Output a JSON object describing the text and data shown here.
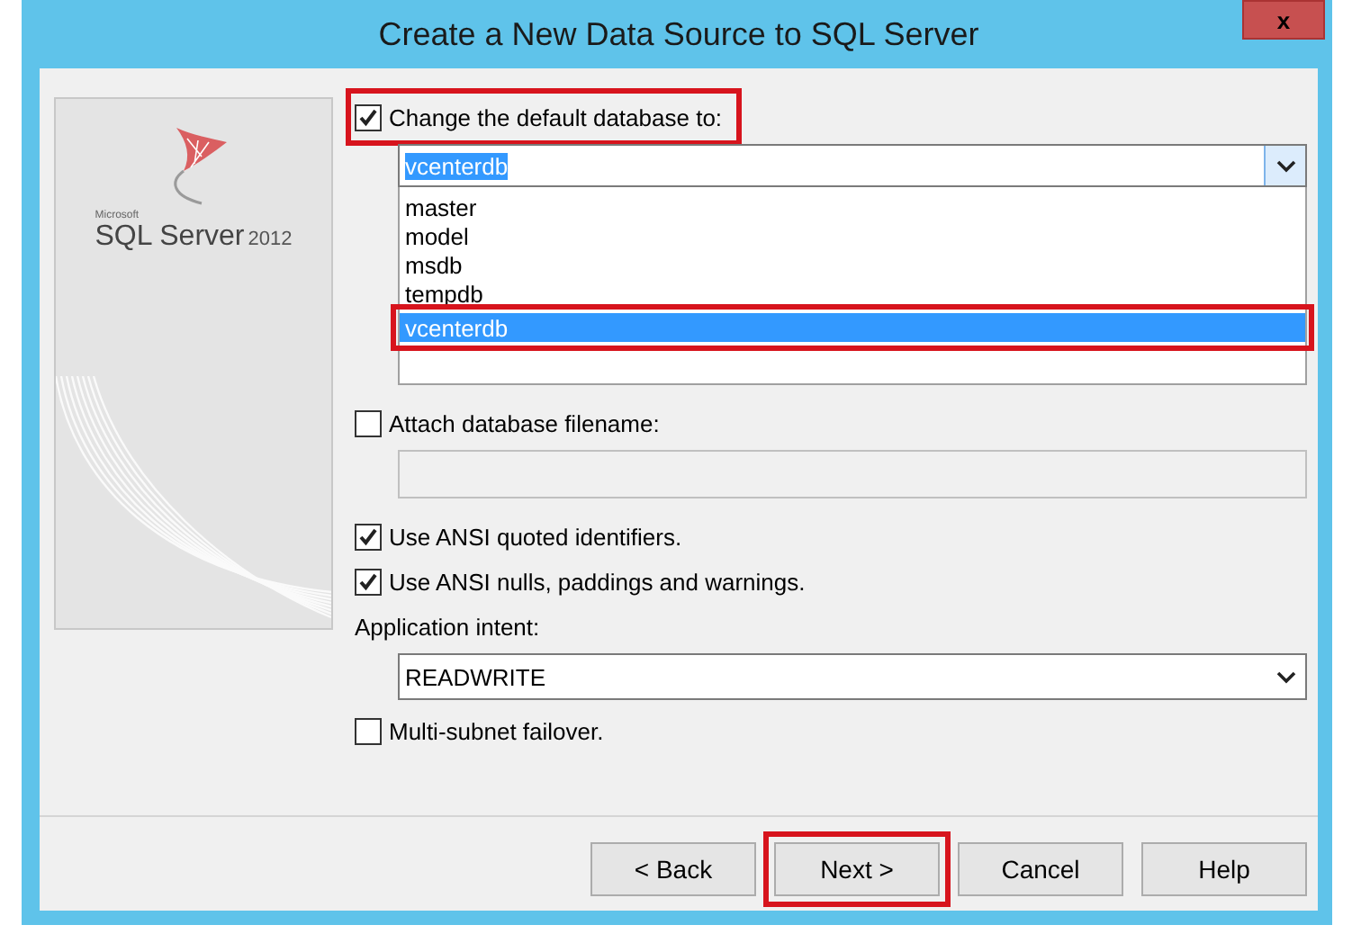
{
  "window": {
    "title": "Create a New Data Source to SQL Server",
    "close": "x"
  },
  "logo": {
    "maker": "Microsoft",
    "product": "SQL Server",
    "version": "2012"
  },
  "default_database": {
    "label": "Change the default database to:",
    "checked": true,
    "highlighted": true,
    "value": "vcenterdb",
    "options": [
      {
        "label": "master",
        "selected": false,
        "highlighted": false
      },
      {
        "label": "model",
        "selected": false,
        "highlighted": false
      },
      {
        "label": "msdb",
        "selected": false,
        "highlighted": false
      },
      {
        "label": "tempdb",
        "selected": false,
        "highlighted": false
      },
      {
        "label": "vcenterdb",
        "selected": true,
        "highlighted": true
      }
    ]
  },
  "attach": {
    "label": "Attach database filename:",
    "checked": false,
    "disabled": true
  },
  "options": [
    {
      "label": "Use ANSI quoted identifiers.",
      "checked": true
    },
    {
      "label": "Use ANSI nulls, paddings and warnings.",
      "checked": true
    }
  ],
  "intent": {
    "label": "Application intent:",
    "value": "READWRITE"
  },
  "failover": {
    "label": "Multi-subnet failover.",
    "checked": false
  },
  "buttons": [
    {
      "label": "< Back",
      "highlighted": false
    },
    {
      "label": "Next >",
      "highlighted": true
    },
    {
      "label": "Cancel",
      "highlighted": false
    },
    {
      "label": "Help",
      "highlighted": false
    }
  ]
}
